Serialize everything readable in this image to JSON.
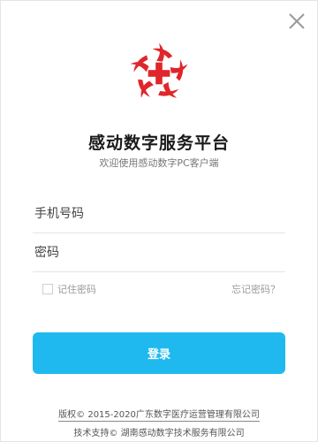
{
  "window": {
    "close_icon": "close-icon"
  },
  "brand": {
    "logo_icon": "red-cross-swirl-logo",
    "title": "感动数字服务平台",
    "subtitle": "欢迎使用感动数字PC客户端",
    "logo_color": "#e0262a"
  },
  "form": {
    "phone_placeholder": "手机号码",
    "phone_value": "",
    "password_placeholder": "密码",
    "password_value": "",
    "remember_label": "记住密码",
    "remember_checked": false,
    "forgot_label": "忘记密码？",
    "login_label": "登录"
  },
  "footer": {
    "copyright": "版权© 2015-2020广东数字医疗运营管理有限公司",
    "support": "技术支持© 湖南感动数字技术服务有限公司"
  },
  "colors": {
    "accent": "#1fb9ef",
    "brand_red": "#e0262a"
  }
}
